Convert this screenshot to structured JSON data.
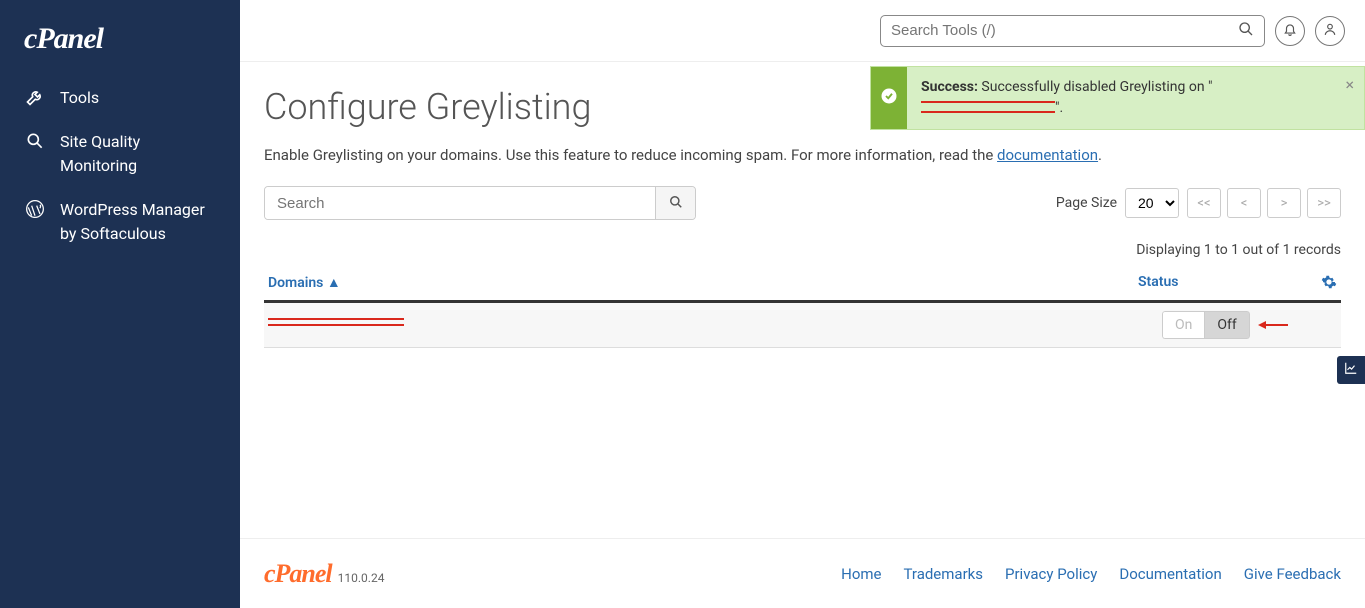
{
  "sidebar": {
    "logo_text": "cPanel",
    "items": [
      {
        "label": "Tools"
      },
      {
        "label": "Site Quality Monitoring"
      },
      {
        "label": "WordPress Manager by Softaculous"
      }
    ]
  },
  "topbar": {
    "search_placeholder": "Search Tools (/)"
  },
  "alert": {
    "prefix": "Success:",
    "text_before": " Successfully disabled Greylisting on \"",
    "text_after": "\"."
  },
  "page": {
    "title": "Configure Greylisting",
    "description_prefix": "Enable Greylisting on your domains. Use this feature to reduce incoming spam. For more information, read the ",
    "doc_link": "documentation",
    "description_suffix": "."
  },
  "filter": {
    "search_placeholder": "Search",
    "page_size_label": "Page Size",
    "page_size_value": "20",
    "first": "<<",
    "prev": "<",
    "next": ">",
    "last": ">>"
  },
  "display_text": "Displaying 1 to 1 out of 1 records",
  "table": {
    "col_domains": "Domains ▲",
    "col_status": "Status",
    "toggle_on": "On",
    "toggle_off": "Off"
  },
  "footer": {
    "logo": "cPanel",
    "version": "110.0.24",
    "links": [
      "Home",
      "Trademarks",
      "Privacy Policy",
      "Documentation",
      "Give Feedback"
    ]
  }
}
